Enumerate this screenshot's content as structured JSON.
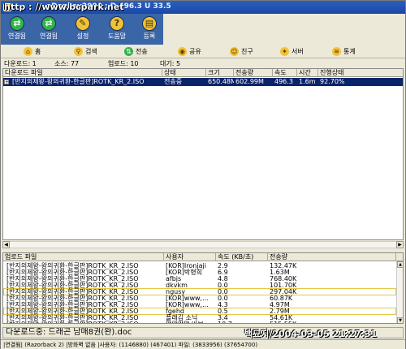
{
  "window": {
    "title": "eDonkey2000 : D 496.3 U 33.5"
  },
  "watermark_top": "http : //www.bcpark.net",
  "watermark_bottom": "백묘지/2004-03-05 21:27:31",
  "main_toolbar": [
    {
      "label": "연결됨",
      "icon": "connect-icon",
      "glyph": "⇄"
    },
    {
      "label": "연결됨",
      "icon": "disconnect-icon",
      "glyph": "⇄"
    },
    {
      "label": "설정",
      "icon": "settings-icon",
      "glyph": "✎"
    },
    {
      "label": "도움말",
      "icon": "help-icon",
      "glyph": "?"
    },
    {
      "label": "등록",
      "icon": "register-icon",
      "glyph": "▤"
    }
  ],
  "tabs": [
    {
      "label": "홈",
      "icon": "home-icon",
      "glyph": "⌂"
    },
    {
      "label": "검색",
      "icon": "search-icon",
      "glyph": "⚲"
    },
    {
      "label": "전송",
      "icon": "transfer-icon",
      "glyph": "⇅"
    },
    {
      "label": "공유",
      "icon": "share-icon",
      "glyph": "◉"
    },
    {
      "label": "친구",
      "icon": "friend-icon",
      "glyph": "☺"
    },
    {
      "label": "서버",
      "icon": "server-icon",
      "glyph": "✦"
    },
    {
      "label": "통계",
      "icon": "stats-icon",
      "glyph": "≋"
    }
  ],
  "counters": {
    "downloads": "다운로드: 1",
    "sources": "소스: 77",
    "uploads": "업로드: 10",
    "queue": "대기: 5"
  },
  "download_list": {
    "columns": [
      "다운로드 파일",
      "상태",
      "크기",
      "전송량",
      "속도",
      "시간",
      "진행상태"
    ],
    "rows": [
      {
        "file": "[반지의제왕-왕의귀환-한글판]ROTK_KR_2.ISO",
        "status": "전송중",
        "size": "650.48M",
        "transferred": "602.99M",
        "speed": "496.3",
        "time": "1.6m",
        "progress": "92.70%"
      }
    ]
  },
  "upload_list": {
    "columns": [
      "업로드 파일",
      "사용자",
      "속도 (KB/초)",
      "전송량"
    ],
    "rows": [
      {
        "file": "[반지의제왕-왕의귀환-한글판]ROTK_KR_2.ISO",
        "user": "[KOR]Ironjaji",
        "speed": "2.9",
        "amount": "132.47K",
        "highlight": false
      },
      {
        "file": "[반지의제왕-왕의귀환-한글판]ROTK_KR_2.ISO",
        "user": "[KOR]박형희",
        "speed": "6.9",
        "amount": "1.63M",
        "highlight": false
      },
      {
        "file": "[반지의제왕-왕의귀환-한글판]ROTK_KR_2.ISO",
        "user": "afbjs",
        "speed": "4.8",
        "amount": "768.40K",
        "highlight": false
      },
      {
        "file": "[반지의제왕-왕의귀환-한글판]ROTK_KR_2.ISO",
        "user": "dkvkm",
        "speed": "0.0",
        "amount": "101.70K",
        "highlight": false
      },
      {
        "file": "[반지의제왕-왕의귀환-한글판]ROTK_KR_2.ISO",
        "user": "ngusy",
        "speed": "0.0",
        "amount": "297.04K",
        "highlight": true
      },
      {
        "file": "[반지의제왕-왕의귀환-한글판]ROTK_KR_2.ISO",
        "user": "[KOR]www,...",
        "speed": "0.0",
        "amount": "60.87K",
        "highlight": false
      },
      {
        "file": "[반지의제왕-왕의귀환-한글판]ROTK_KR_2.ISO",
        "user": "[KOR]www,...",
        "speed": "4.3",
        "amount": "4.97M",
        "highlight": false
      },
      {
        "file": "[반지의제왕-왕의귀환-한글판]ROTK_KR_2.ISO",
        "user": "fgehd",
        "speed": "0.5",
        "amount": "2.79M",
        "highlight": true
      },
      {
        "file": "[반지의제왕-왕의귀환-한글판]ROTK_KR_2.ISO",
        "user": "플래김 소닉",
        "speed": "3.4",
        "amount": "54.61K",
        "highlight": false
      },
      {
        "file": "[반지의제왕-왕의귀환-한글판]ROTK_KR_2.ISO",
        "user": "왕왕왕왕 바보",
        "speed": "10.7",
        "amount": "515.55K",
        "highlight": false
      }
    ]
  },
  "info_bar": "다운로드중: 드래곤 남매8권(완).doc",
  "status_bar": "|연결됨| (Razorback 2) |방화벽 없음 |사용자: (1146880) (467401) 파일: (3833956) (37654700)",
  "colors": {
    "titlebar": "#1b48a8",
    "toolbar_bg": "#3a66a8",
    "selection": "#0a246a",
    "highlight_outline": "#e2c84a",
    "window_bg": "#ece9d8"
  }
}
